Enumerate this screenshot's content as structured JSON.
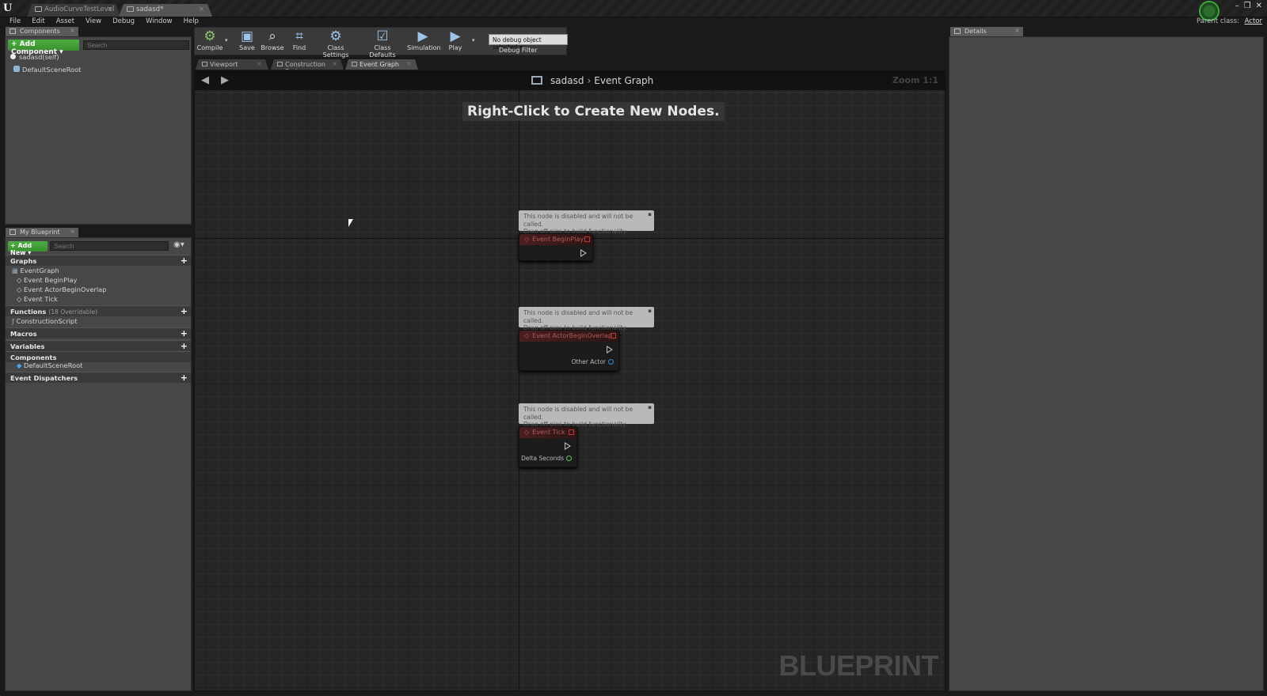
{
  "window": {
    "tabs": [
      {
        "label": "AudioCurveTestLevel"
      },
      {
        "label": "sadasd*"
      }
    ],
    "parent_class_label": "Parent class:",
    "parent_class_value": "Actor"
  },
  "menu": [
    "File",
    "Edit",
    "Asset",
    "View",
    "Debug",
    "Window",
    "Help"
  ],
  "components_panel": {
    "tab_label": "Components",
    "add_component_label": "+ Add Component ▾",
    "search_placeholder": "Search",
    "self_label": "sadasd(self)",
    "root_label": "DefaultSceneRoot"
  },
  "my_blueprint": {
    "tab_label": "My Blueprint",
    "add_new_label": "+ Add New ▾",
    "search_placeholder": "Search",
    "graphs_label": "Graphs",
    "event_graph_label": "EventGraph",
    "events": [
      "Event BeginPlay",
      "Event ActorBeginOverlap",
      "Event Tick"
    ],
    "functions_label": "Functions",
    "functions_sub": "(18 Overridable)",
    "construction_script": "ConstructionScript",
    "macros_label": "Macros",
    "variables_label": "Variables",
    "components_label": "Components",
    "components_item": "DefaultSceneRoot",
    "dispatchers_label": "Event Dispatchers"
  },
  "toolbar": {
    "compile": "Compile",
    "save": "Save",
    "browse": "Browse",
    "find": "Find",
    "class_settings": "Class Settings",
    "class_defaults": "Class Defaults",
    "simulation": "Simulation",
    "play": "Play",
    "debug_object": "No debug object selected ▾",
    "debug_filter": "Debug Filter"
  },
  "graph_tabs": [
    "Viewport",
    "Construction Scrip",
    "Event Graph"
  ],
  "graph": {
    "breadcrumb_root": "sadasd",
    "breadcrumb_leaf": "Event Graph",
    "zoom": "Zoom 1:1",
    "hint": "Right-Click to Create New Nodes.",
    "watermark": "BLUEPRINT",
    "comment_line1": "This node is disabled and will not be called.",
    "comment_line2": "Drag off pins to build functionality.",
    "nodes": [
      {
        "title": "Event BeginPlay"
      },
      {
        "title": "Event ActorBeginOverlap",
        "pin": "Other Actor"
      },
      {
        "title": "Event Tick",
        "pin": "Delta Seconds"
      }
    ]
  },
  "details_panel": {
    "tab_label": "Details"
  }
}
